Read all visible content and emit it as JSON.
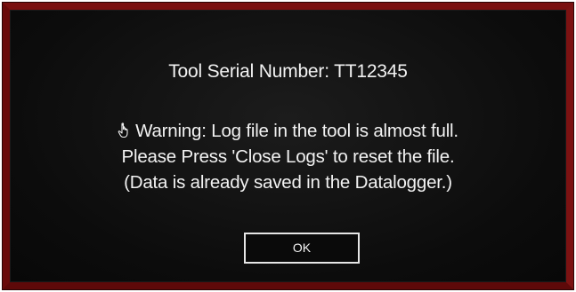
{
  "dialog": {
    "serial_text": "Tool Serial Number: TT12345",
    "message_lines": [
      "Warning: Log file in the tool is almost full.",
      "Please Press 'Close Logs' to reset the file.",
      "(Data is already saved in the Datalogger.)"
    ],
    "warning_icon": "hand-pointer-icon",
    "ok_label": "OK"
  },
  "colors": {
    "frame": "#6e0c0c",
    "background": "#0c0c0c",
    "text": "#f2f2f2"
  }
}
